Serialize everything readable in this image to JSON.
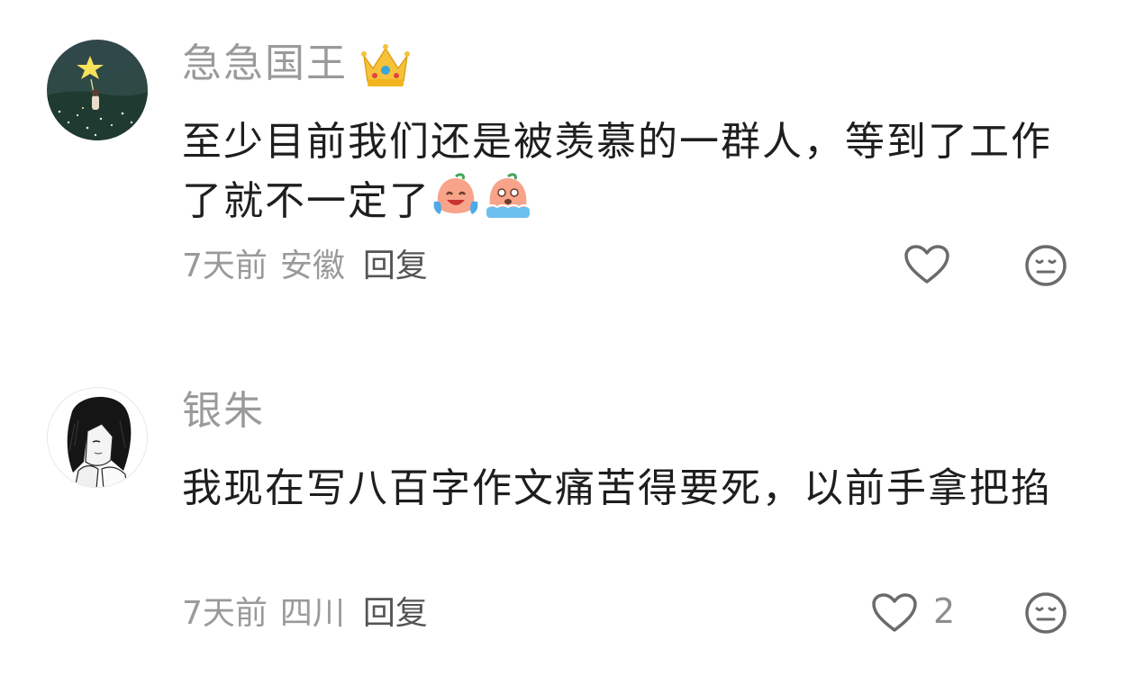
{
  "comments": [
    {
      "username": "急急国王",
      "badge_icon": "crown-icon",
      "text": "至少目前我们还是被羡慕的一群人，等到了工作了就不一定了",
      "emojis": [
        "crying-laughing-peach-emoji",
        "crying-peach-emoji"
      ],
      "time": "7天前",
      "location": "安徽",
      "reply_label": "回复",
      "like_count": "",
      "like_icon": "heart-outline-icon",
      "dislike_icon": "meh-face-icon"
    },
    {
      "username": "银朱",
      "text": "我现在写八百字作文痛苦得要死，以前手拿把掐",
      "time": "7天前",
      "location": "四川",
      "reply_label": "回复",
      "like_count": "2",
      "like_icon": "heart-outline-icon",
      "dislike_icon": "meh-face-icon"
    }
  ],
  "colors": {
    "username": "#9a9a9a",
    "text": "#1e1e1e",
    "meta": "#9a9a9a",
    "reply": "#555555",
    "icon": "#6b6b6b"
  }
}
